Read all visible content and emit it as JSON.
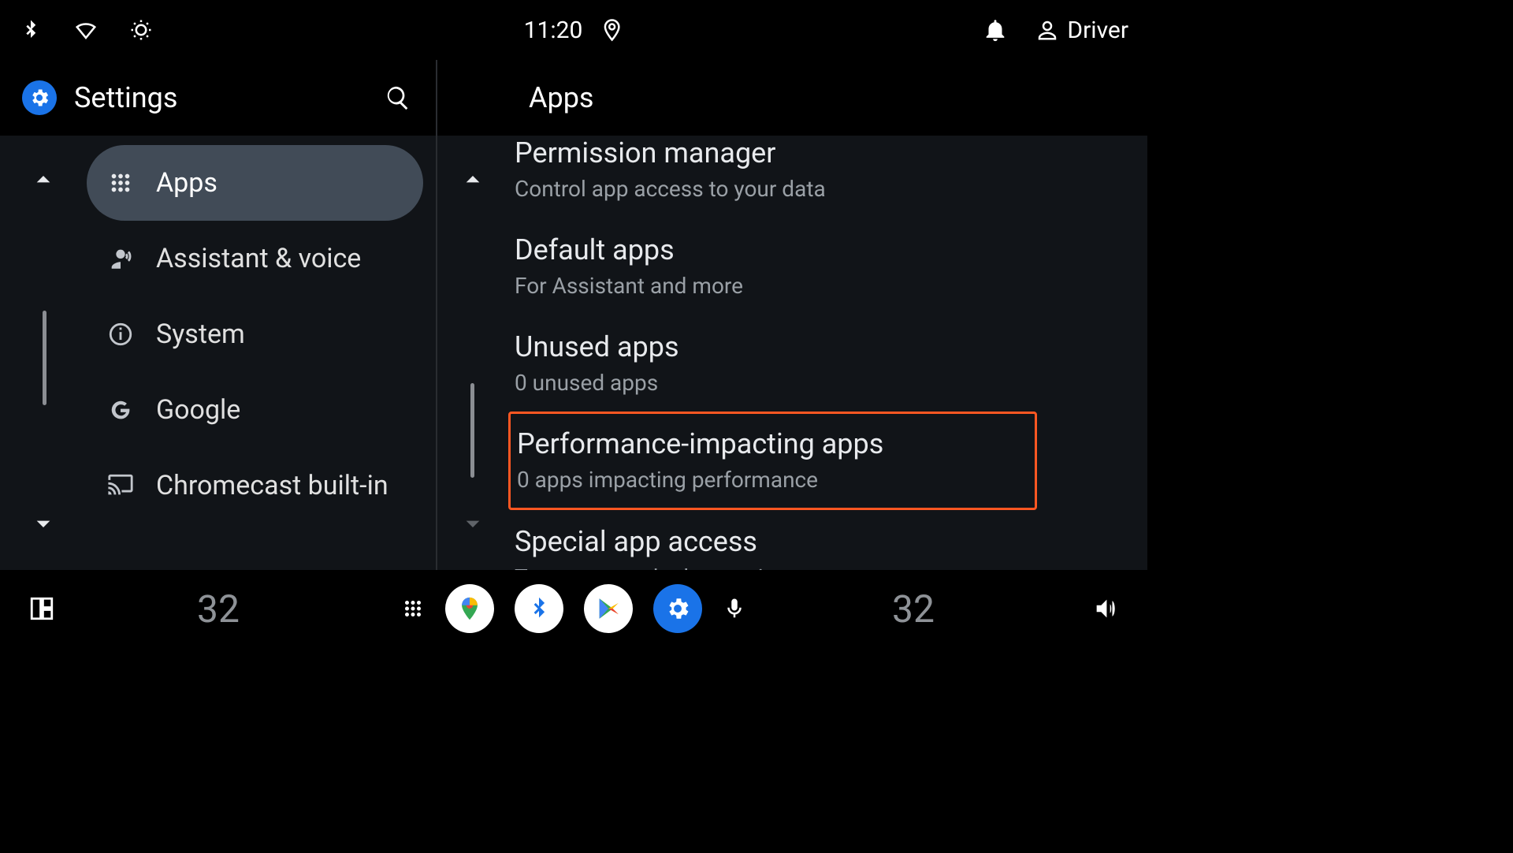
{
  "status": {
    "time": "11:20",
    "user_label": "Driver"
  },
  "left": {
    "title": "Settings",
    "items": [
      {
        "label": "Apps"
      },
      {
        "label": "Assistant & voice"
      },
      {
        "label": "System"
      },
      {
        "label": "Google"
      },
      {
        "label": "Chromecast built-in"
      }
    ]
  },
  "right": {
    "title": "Apps",
    "items": [
      {
        "title": "Permission manager",
        "sub": "Control app access to your data"
      },
      {
        "title": "Default apps",
        "sub": "For Assistant and more"
      },
      {
        "title": "Unused apps",
        "sub": "0 unused apps"
      },
      {
        "title": "Performance-impacting apps",
        "sub": "0 apps impacting performance"
      },
      {
        "title": "Special app access",
        "sub": "To system and other settings"
      }
    ],
    "highlight_index": 3
  },
  "bottom": {
    "temp_left": "32",
    "temp_right": "32"
  }
}
